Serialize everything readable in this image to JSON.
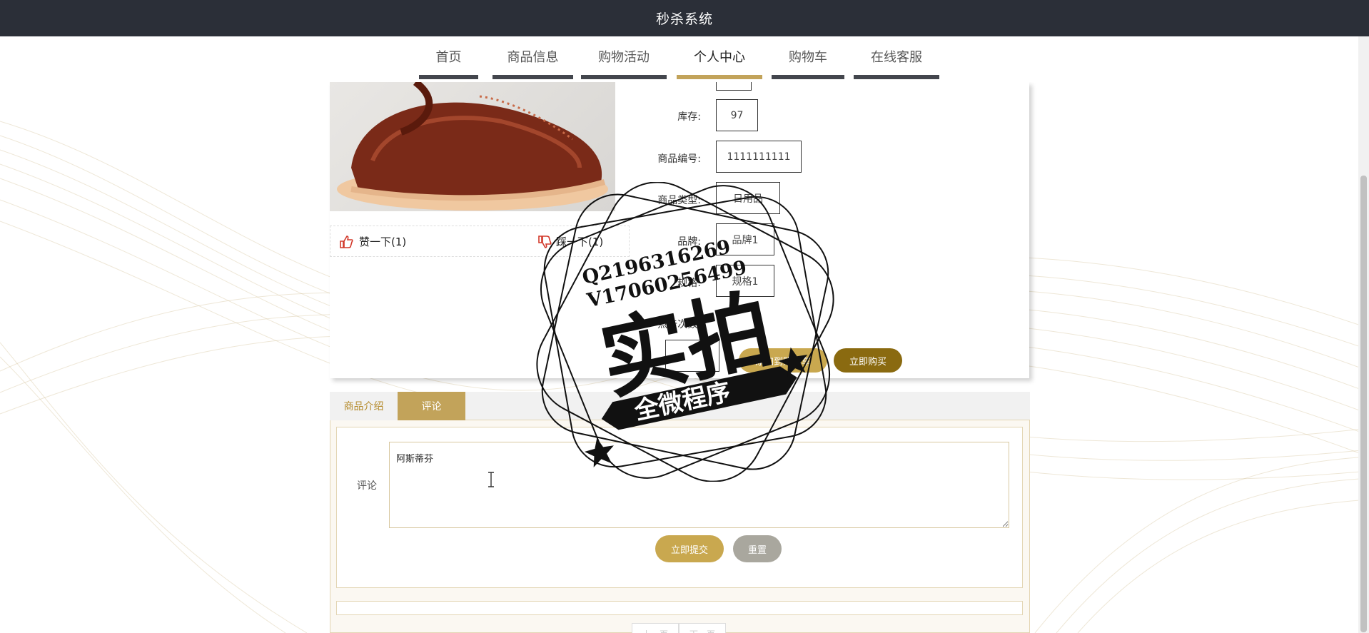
{
  "app": {
    "title": "秒杀系统"
  },
  "nav": {
    "items": [
      {
        "label": "首页"
      },
      {
        "label": "商品信息"
      },
      {
        "label": "购物活动"
      },
      {
        "label": "个人中心"
      },
      {
        "label": "购物车"
      },
      {
        "label": "在线客服"
      }
    ],
    "active": "个人中心"
  },
  "product": {
    "fields": [
      {
        "label": "库存:",
        "value": "97"
      },
      {
        "label": "商品编号:",
        "value": "1111111111"
      },
      {
        "label": "商品类型:",
        "value": "日用品"
      },
      {
        "label": "品牌:",
        "value": "品牌1"
      },
      {
        "label": "规格:",
        "value": "规格1"
      },
      {
        "label": "点击次数:",
        "value": ""
      }
    ],
    "like_label": "赞一下(1)",
    "dislike_label": "踩一下(1)",
    "add_cart_label": "添加到购物车",
    "buy_now_label": "立即购买"
  },
  "tabs": {
    "intro_label": "商品介绍",
    "comment_label": "评论"
  },
  "comment": {
    "label": "评论",
    "value": "阿斯蒂芬",
    "submit_label": "立即提交",
    "reset_label": "重置"
  },
  "pager": {
    "prev_label": "上一页",
    "next_label": "下一页"
  },
  "watermark": {
    "line1": "Q2196316269",
    "line2": "V17060256499",
    "main": "实拍",
    "banner": "全微程序"
  },
  "colors": {
    "accent": "#c2a35a",
    "header": "#2b2f38",
    "buy": "#8a6a10",
    "reset": "#a9a79e"
  }
}
